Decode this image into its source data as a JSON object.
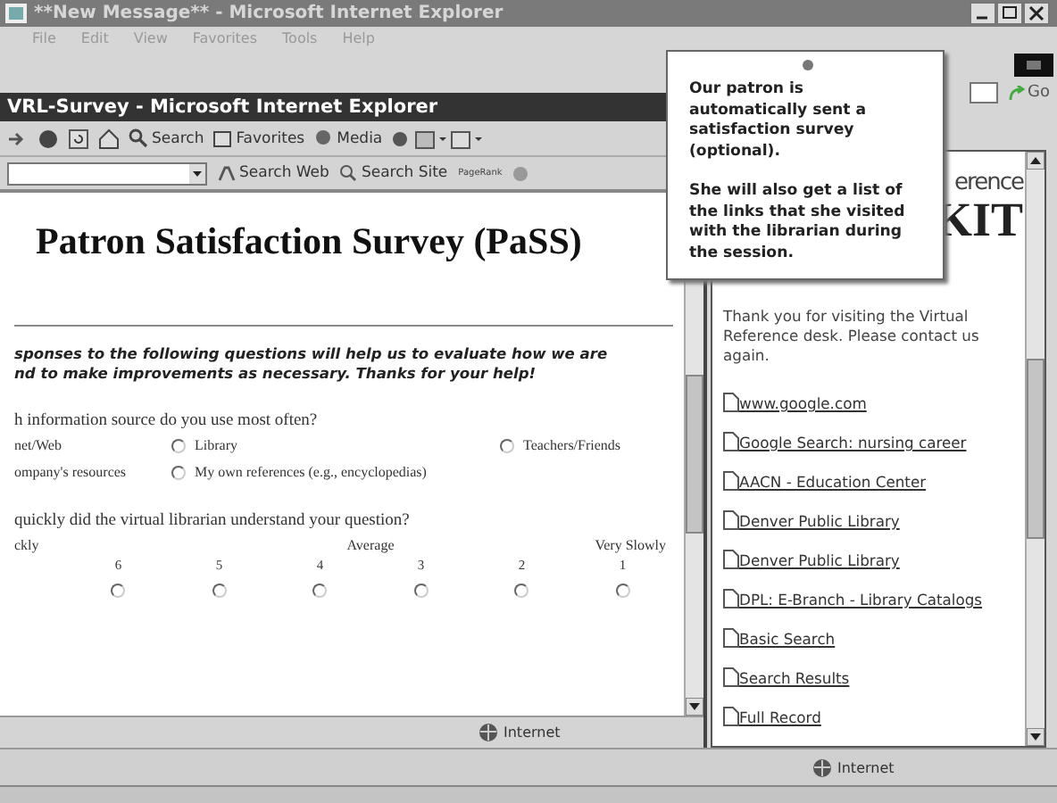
{
  "back_window": {
    "title": "**New Message** - Microsoft Internet Explorer",
    "menu": [
      "File",
      "Edit",
      "View",
      "Favorites",
      "Tools",
      "Help"
    ],
    "go_button": "Go",
    "logo": [
      "erence",
      "KIT"
    ],
    "message": "Thank you for visiting the Virtual Reference desk. Please contact us again.",
    "links": [
      "www.google.com",
      "Google Search: nursing career",
      "AACN - Education Center",
      "Denver Public Library",
      "Denver Public Library",
      "DPL: E-Branch - Library Catalogs",
      "Basic Search",
      "Search Results",
      "Full Record"
    ],
    "status": "Internet"
  },
  "survey_window": {
    "title": "VRL-Survey - Microsoft Internet Explorer",
    "toolbar": [
      "Search",
      "Favorites",
      "Media"
    ],
    "search_bar": [
      "Search Web",
      "Search Site"
    ],
    "pagerank": "PageRank",
    "heading": "Patron Satisfaction Survey (PaSS)",
    "intro": [
      "sponses to the following questions will help us to evaluate how we are",
      "nd to make improvements as necessary. Thanks for your help!"
    ],
    "questions": [
      {
        "kind": "choice",
        "text": "h information source do you use most often?",
        "options": [
          {
            "label": "net/Web"
          },
          {
            "label": "Library",
            "selected": false
          },
          {
            "label": "Teachers/Friends",
            "selected": false
          },
          {
            "label": "ompany's resources"
          },
          {
            "label": "My own references (e.g., encyclopedias)",
            "selected": false
          }
        ]
      },
      {
        "kind": "scale",
        "text": "quickly did the virtual librarian understand your question?",
        "anchors": [
          "ckly",
          "Average",
          "Very Slowly"
        ],
        "points": [
          {
            "label": "6",
            "selected": false
          },
          {
            "label": "5",
            "selected": false
          },
          {
            "label": "4",
            "selected": false
          },
          {
            "label": "3",
            "selected": false
          },
          {
            "label": "2",
            "selected": false
          },
          {
            "label": "1",
            "selected": false
          }
        ]
      }
    ],
    "status": "Internet"
  },
  "callout": {
    "paragraphs": [
      "Our patron is automatically sent a satisfaction survey (optional).",
      "She will also get a list of the links that she visited with the librarian during the session."
    ]
  }
}
